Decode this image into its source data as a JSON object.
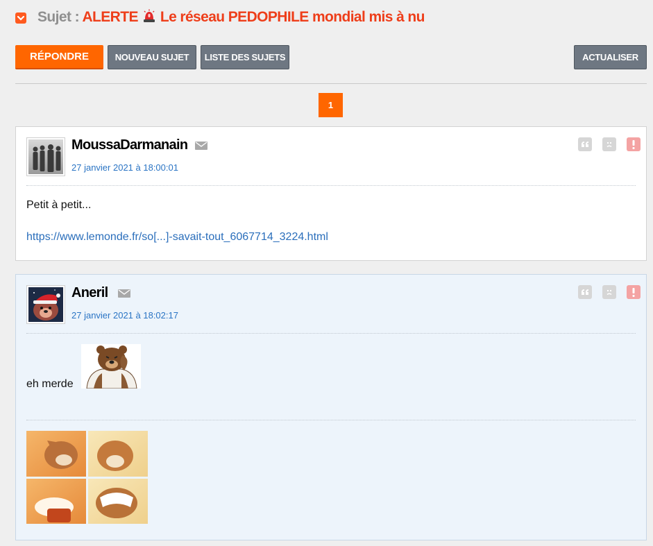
{
  "topic": {
    "prefix": "Sujet :",
    "title_before_icon": "ALERTE",
    "title_after_icon": "Le réseau PEDOPHILE mondial mis à nu",
    "title_icon": "siren-icon"
  },
  "toolbar": {
    "reply_label": "RÉPONDRE",
    "new_topic_label": "NOUVEAU SUJET",
    "topic_list_label": "LISTE DES SUJETS",
    "refresh_label": "ACTUALISER"
  },
  "pagination": {
    "current_page": "1"
  },
  "colors": {
    "accent": "#ff6600",
    "title": "#ee3e1a",
    "link": "#2a6ebb",
    "button_grey": "#6e7782"
  },
  "posts": [
    {
      "author": "MoussaDarmanain",
      "date": "27 janvier 2021 à 18:00:01",
      "text": "Petit à petit...",
      "link": "https://www.lemonde.fr/so[...]-savait-tout_6067714_3224.html",
      "icons": [
        "mail-icon",
        "quote-icon",
        "sad-face-icon",
        "alert-icon"
      ]
    },
    {
      "author": "Aneril",
      "date": "27 janvier 2021 à 18:02:17",
      "text": "eh merde",
      "icons": [
        "mail-icon",
        "quote-icon",
        "sad-face-icon",
        "alert-icon"
      ]
    }
  ]
}
